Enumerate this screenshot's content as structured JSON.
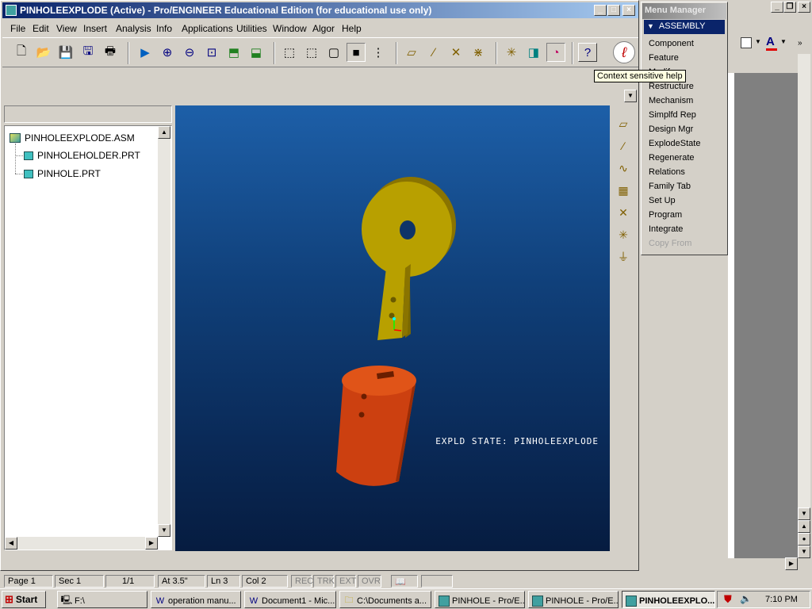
{
  "window": {
    "title": "PINHOLEEXPLODE (Active) - Pro/ENGINEER Educational Edition (for educational use only)",
    "min": "_",
    "max": "□",
    "close": "×"
  },
  "menu": [
    "File",
    "Edit",
    "View",
    "Insert",
    "Analysis",
    "Info",
    "Applications",
    "Utilities",
    "Window",
    "Algor",
    "Help"
  ],
  "tooltip": "Context sensitive help",
  "model_tree": {
    "root": "PINHOLEEXPLODE.ASM",
    "items": [
      "PINHOLEHOLDER.PRT",
      "PINHOLE.PRT"
    ]
  },
  "viewport": {
    "state_label": "EXPLD STATE: PINHOLEEXPLODE",
    "colors": {
      "holder": "#b8a000",
      "pinhole": "#cc4010",
      "bg_top": "#1d5fa8",
      "bg_bottom": "#061c40"
    }
  },
  "menu_manager": {
    "title": "Menu Manager",
    "section": "ASSEMBLY",
    "items": [
      "Component",
      "Feature",
      "Modify",
      "Restructure",
      "Mechanism",
      "Simplfd Rep",
      "Design Mgr",
      "ExplodeState",
      "Regenerate",
      "Relations",
      "Family Tab",
      "Set Up",
      "Program",
      "Integrate"
    ],
    "disabled_item": "Copy From"
  },
  "status": {
    "page": "Page 1",
    "sec": "Sec 1",
    "frac": "1/1",
    "at": "At 3.5\"",
    "ln": "Ln 3",
    "col": "Col 2",
    "rec": "REC",
    "trk": "TRK",
    "ext": "EXT",
    "ovr": "OVR"
  },
  "taskbar": {
    "start": "Start",
    "tasks": [
      "F:\\",
      "operation manu...",
      "Document1 - Mic...",
      "C:\\Documents a...",
      "PINHOLE - Pro/E...",
      "PINHOLE - Pro/E...",
      "PINHOLEEXPLO..."
    ],
    "time": "7:10 PM"
  },
  "word": {
    "font_color_label": "A"
  }
}
